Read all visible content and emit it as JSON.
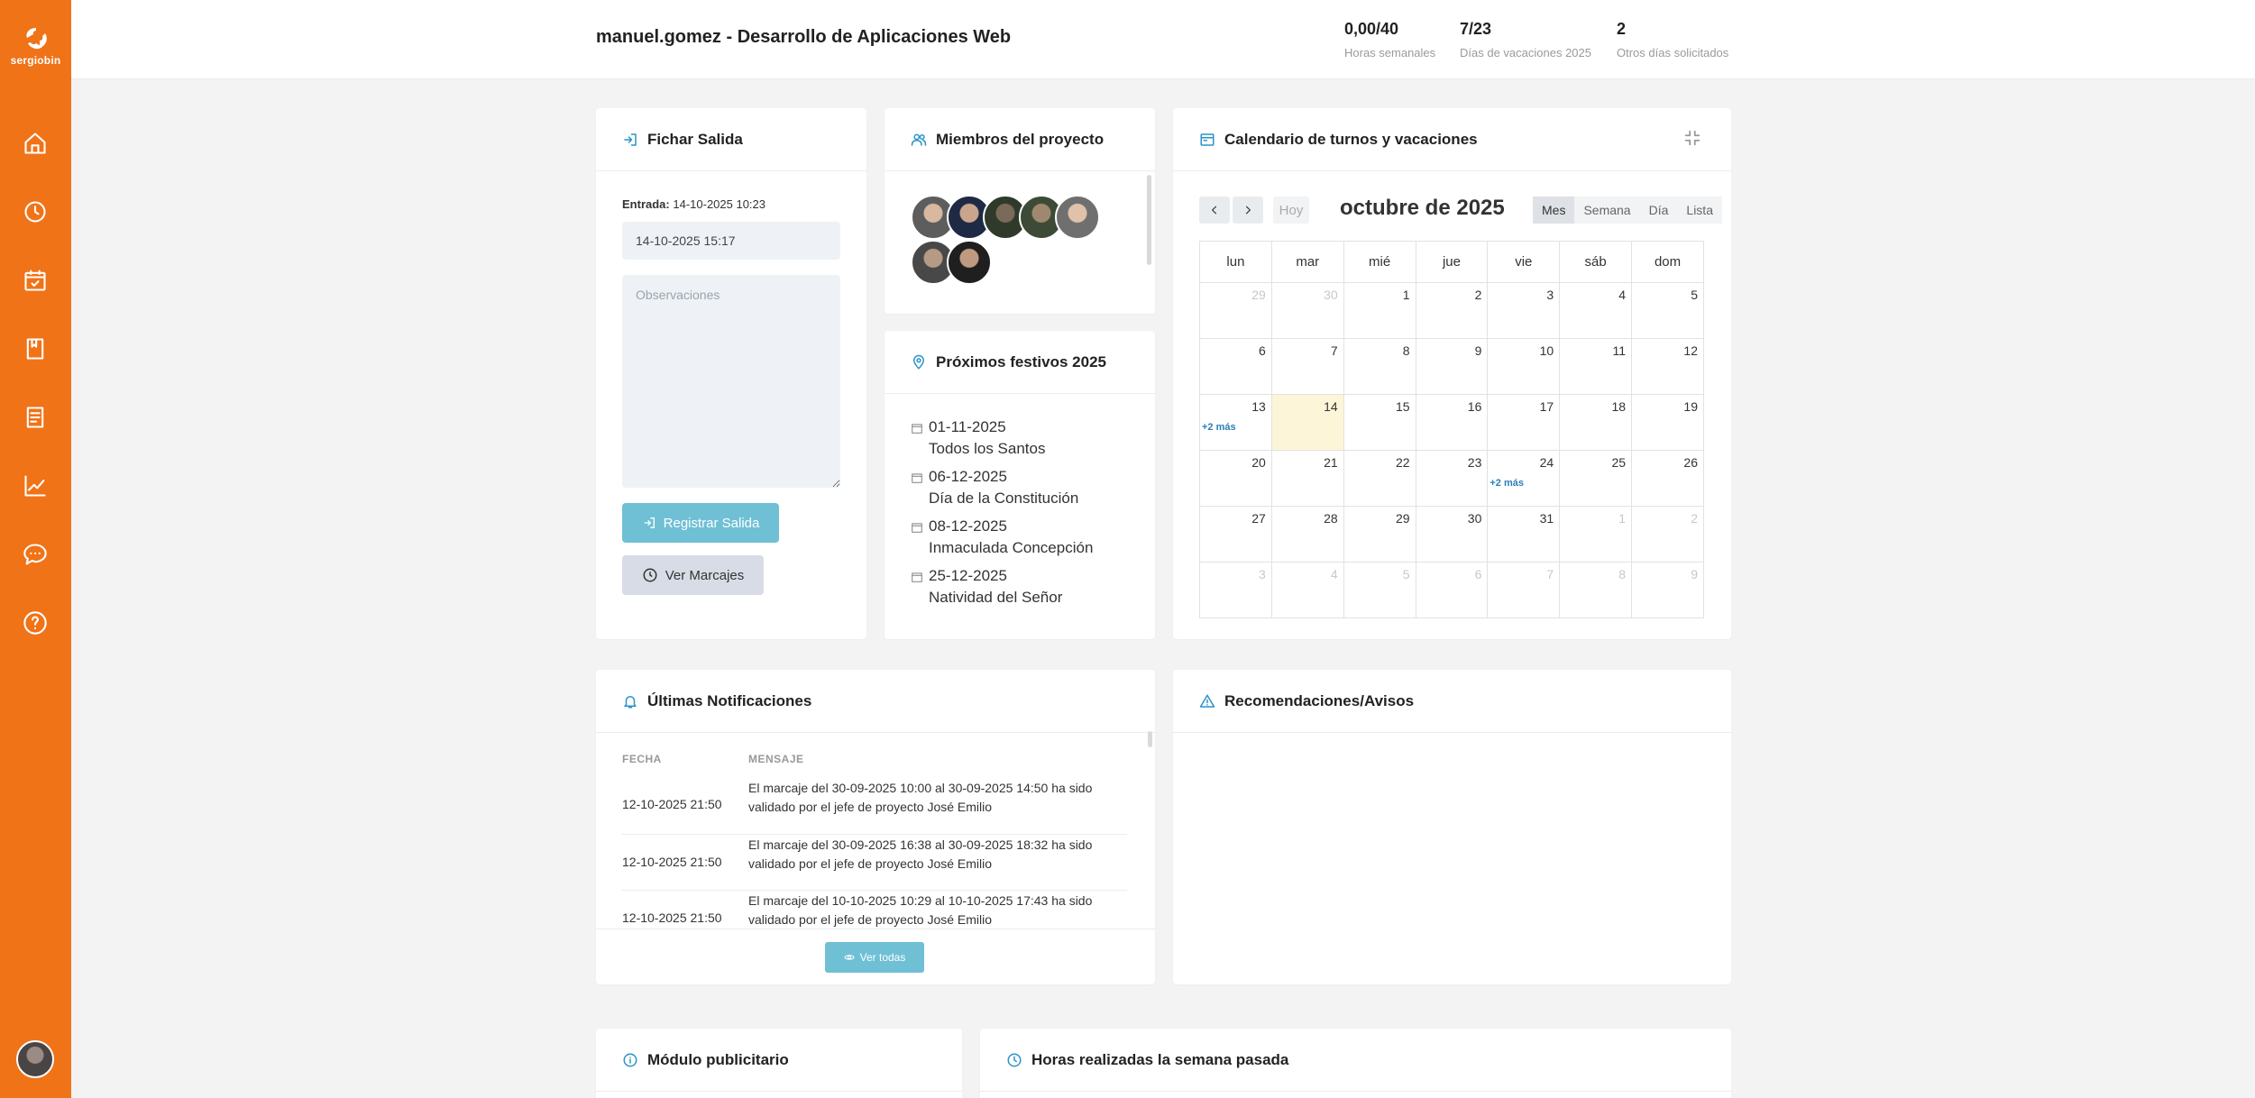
{
  "brand": "sergiobin",
  "header": {
    "title": "manuel.gomez - Desarrollo de Aplicaciones Web",
    "stats": [
      {
        "value": "0,00/40",
        "label": "Horas semanales"
      },
      {
        "value": "7/23",
        "label": "Días de vacaciones 2025"
      },
      {
        "value": "2",
        "label": "Otros días solicitados"
      }
    ]
  },
  "sidebar": {
    "items": [
      "home-icon",
      "clock-icon",
      "calendar-check-icon",
      "book-icon",
      "document-icon",
      "chart-line-icon",
      "chat-icon",
      "help-icon"
    ]
  },
  "fichar": {
    "title": "Fichar Salida",
    "entrada_label": "Entrada:",
    "entrada_value": "14-10-2025 10:23",
    "salida_value": "14-10-2025 15:17",
    "obs_placeholder": "Observaciones",
    "register_label": "Registrar Salida",
    "ver_label": "Ver Marcajes"
  },
  "miembros": {
    "title": "Miembros del proyecto",
    "count": 7
  },
  "festivos": {
    "title": "Próximos festivos 2025",
    "items": [
      {
        "date": "01-11-2025",
        "name": "Todos los Santos"
      },
      {
        "date": "06-12-2025",
        "name": "Día de la Constitución"
      },
      {
        "date": "08-12-2025",
        "name": "Inmaculada Concepción"
      },
      {
        "date": "25-12-2025",
        "name": "Natividad del Señor"
      }
    ]
  },
  "calendar": {
    "title": "Calendario de turnos y vacaciones",
    "hoy": "Hoy",
    "month": "octubre de 2025",
    "views": [
      "Mes",
      "Semana",
      "Día",
      "Lista"
    ],
    "active_view": "Mes",
    "days": [
      "lun",
      "mar",
      "mié",
      "jue",
      "vie",
      "sáb",
      "dom"
    ],
    "weeks": [
      [
        "29",
        "30",
        "1",
        "2",
        "3",
        "4",
        "5"
      ],
      [
        "6",
        "7",
        "8",
        "9",
        "10",
        "11",
        "12"
      ],
      [
        "13",
        "14",
        "15",
        "16",
        "17",
        "18",
        "19"
      ],
      [
        "20",
        "21",
        "22",
        "23",
        "24",
        "25",
        "26"
      ],
      [
        "27",
        "28",
        "29",
        "30",
        "31",
        "1",
        "2"
      ],
      [
        "3",
        "4",
        "5",
        "6",
        "7",
        "8",
        "9"
      ]
    ],
    "more_label": "+2 más"
  },
  "notificaciones": {
    "title": "Últimas Notificaciones",
    "col_fecha": "FECHA",
    "col_mensaje": "MENSAJE",
    "rows": [
      {
        "fecha": "12-10-2025 21:50",
        "mensaje": "El marcaje del 30-09-2025 10:00 al 30-09-2025 14:50 ha sido validado por el jefe de proyecto José Emilio"
      },
      {
        "fecha": "12-10-2025 21:50",
        "mensaje": "El marcaje del 30-09-2025 16:38 al 30-09-2025 18:32 ha sido validado por el jefe de proyecto José Emilio"
      },
      {
        "fecha": "12-10-2025 21:50",
        "mensaje": "El marcaje del 10-10-2025 10:29 al 10-10-2025 17:43 ha sido validado por el jefe de proyecto José Emilio"
      }
    ],
    "ver_todas": "Ver todas"
  },
  "recomendaciones": {
    "title": "Recomendaciones/Avisos"
  },
  "publicitario": {
    "title": "Módulo publicitario"
  },
  "horas": {
    "title": "Horas realizadas la semana pasada"
  },
  "colors": {
    "accent": "#f07318",
    "info": "#2a93c9",
    "button": "#6fc0d5"
  }
}
